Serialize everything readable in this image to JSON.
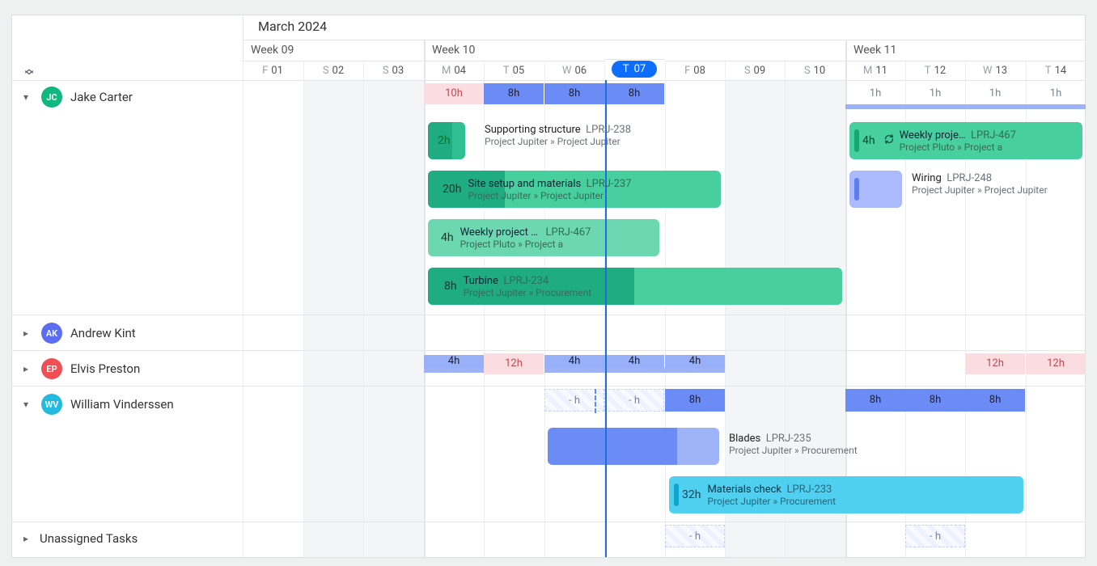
{
  "month": "March 2024",
  "weeks": [
    {
      "label": "Week 09"
    },
    {
      "label": "Week 10"
    },
    {
      "label": "Week 11"
    }
  ],
  "days": [
    {
      "dow": "F",
      "day": "01"
    },
    {
      "dow": "S",
      "day": "02"
    },
    {
      "dow": "S",
      "day": "03"
    },
    {
      "dow": "M",
      "day": "04"
    },
    {
      "dow": "T",
      "day": "05"
    },
    {
      "dow": "W",
      "day": "06"
    },
    {
      "dow": "T",
      "day": "07",
      "today": true
    },
    {
      "dow": "F",
      "day": "08"
    },
    {
      "dow": "S",
      "day": "09"
    },
    {
      "dow": "S",
      "day": "10"
    },
    {
      "dow": "M",
      "day": "11"
    },
    {
      "dow": "T",
      "day": "12"
    },
    {
      "dow": "W",
      "day": "13"
    },
    {
      "dow": "T",
      "day": "14"
    }
  ],
  "people": {
    "jake": {
      "initials": "JC",
      "name": "Jake Carter"
    },
    "andrew": {
      "initials": "AK",
      "name": "Andrew Kint"
    },
    "elvis": {
      "initials": "EP",
      "name": "Elvis Preston"
    },
    "william": {
      "initials": "WV",
      "name": "William Vinderssen"
    }
  },
  "unassigned_label": "Unassigned Tasks",
  "hours": {
    "jake": [
      "10h",
      "8h",
      "8h",
      "8h",
      "1h",
      "1h",
      "1h",
      "1h"
    ],
    "elvis": [
      "4h",
      "12h",
      "4h",
      "4h",
      "4h",
      "12h",
      "12h"
    ],
    "william": [
      "- h",
      "- h",
      "8h",
      "8h",
      "8h",
      "8h"
    ],
    "unassigned": [
      "- h",
      "- h"
    ]
  },
  "tasks": {
    "supporting": {
      "hrs": "2h",
      "title": "Supporting structure",
      "code": "LPRJ-238",
      "sub": "Project Jupiter » Project Jupiter"
    },
    "sitesetup": {
      "hrs": "20h",
      "title": "Site setup and materials",
      "code": "LPRJ-237",
      "sub": "Project Jupiter » Project Jupiter"
    },
    "weekly1": {
      "hrs": "4h",
      "title": "Weekly project …",
      "code": "LPRJ-467",
      "sub": "Project Pluto » Project a"
    },
    "turbine": {
      "hrs": "8h",
      "title": "Turbine",
      "code": "LPRJ-234",
      "sub": "Project Jupiter » Procurement"
    },
    "weekly2": {
      "hrs": "4h",
      "title": "Weekly proje…",
      "code": "LPRJ-467",
      "sub": "Project Pluto » Project a"
    },
    "wiring": {
      "title": "Wiring",
      "code": "LPRJ-248",
      "sub": "Project Jupiter » Project Jupiter"
    },
    "blades": {
      "title": "Blades",
      "code": "LPRJ-235",
      "sub": "Project Jupiter » Procurement"
    },
    "materials": {
      "hrs": "32h",
      "title": "Materials check",
      "code": "LPRJ-233",
      "sub": "Project Jupiter » Procurement"
    }
  }
}
